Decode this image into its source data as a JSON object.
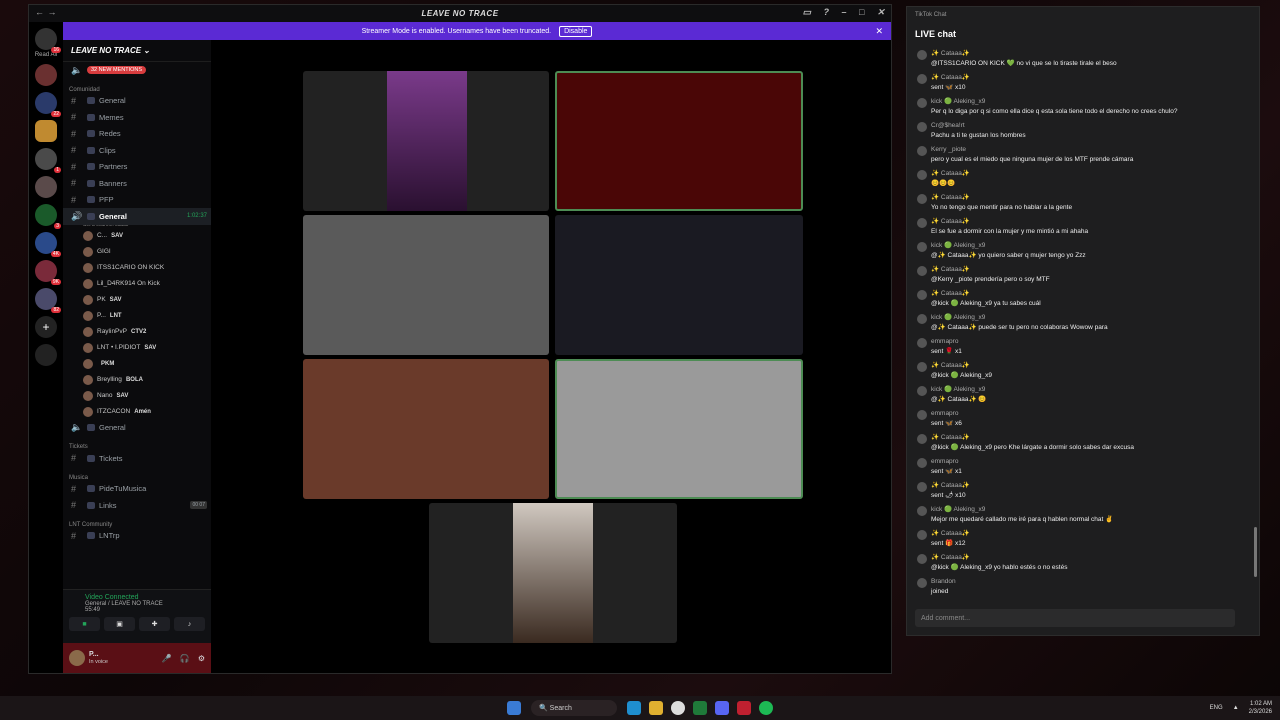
{
  "discord": {
    "window_title": "LEAVE NO TRACE",
    "read_all": "Read All",
    "banner": {
      "text": "Streamer Mode is enabled. Usernames have been truncated.",
      "disable": "Disable"
    },
    "guild_name": "LEAVE NO TRACE",
    "mentions": "32 NEW MENTIONS",
    "cat_comunidad": "Comunidad",
    "channels": [
      "General",
      "Memes",
      "Redes",
      "Clips",
      "Partners",
      "Banners",
      "PFP"
    ],
    "voice_channel": "General",
    "voice_time": "1:02:37",
    "voice_status": "Set a channel status",
    "voice_users": [
      {
        "name": "C...",
        "tag": "SAV"
      },
      {
        "name": "GIGI",
        "tag": ""
      },
      {
        "name": "ITSS1CARIO ON KICK",
        "tag": ""
      },
      {
        "name": "Lil_D4RK914 On Kick",
        "tag": ""
      },
      {
        "name": "PK",
        "tag": "SAV"
      },
      {
        "name": "P...",
        "tag": "LNT"
      },
      {
        "name": "RaylinPvP",
        "tag": "CTV2"
      },
      {
        "name": "LNT • I.PIDIOT",
        "tag": "SAV"
      },
      {
        "name": "",
        "tag": "PKM"
      },
      {
        "name": "Breylling",
        "tag": "BOLA"
      },
      {
        "name": "Nano",
        "tag": "SAV"
      },
      {
        "name": "ITZCACON",
        "tag": "Amén"
      }
    ],
    "voice_channel2": "General",
    "cat_tickets": "Tickets",
    "tickets": "Tickets",
    "cat_musica": "Musica",
    "musica": [
      "PideTuMusica",
      "Links"
    ],
    "links_counts": "00 07",
    "cat_lnt": "LNT Community",
    "lnt_channel": "LNTrp",
    "vc_status": "Video Connected",
    "vc_channel": "General / LEAVE NO TRACE",
    "vc_time": "55:49",
    "user_name": "P...",
    "user_status": "In voice"
  },
  "chat": {
    "window": "TikTok Chat",
    "title": "LIVE chat",
    "messages": [
      {
        "user": "✨ Cataaa✨",
        "text": "@ITSS1CARIO ON KICK 💚 no vi que se lo tiraste tirale el beso"
      },
      {
        "user": "✨ Cataaa✨",
        "text": "sent 🦋 x10"
      },
      {
        "user": "kick 🟢 Aleking_x9",
        "text": "Per q lo diga por q si como ella dice q esta sola tiene todo el derecho no crees chulo?"
      },
      {
        "user": "Cr@$hea!rt",
        "text": "Pachu a ti te gustan los hombres"
      },
      {
        "user": "Kerry _piote",
        "text": "pero y cual es el miedo que ninguna mujer de los MTF prende cámara"
      },
      {
        "user": "✨ Cataaa✨",
        "text": "😊😊😊"
      },
      {
        "user": "✨ Cataaa✨",
        "text": "Yo no tengo que mentir para no hablar a la gente"
      },
      {
        "user": "✨ Cataaa✨",
        "text": "El se fue a dormir con la mujer y me mintió a mi ahaha"
      },
      {
        "user": "kick 🟢 Aleking_x9",
        "text": "@✨ Cataaa✨ yo quiero saber q mujer tengo yo Zzz"
      },
      {
        "user": "✨ Cataaa✨",
        "text": "@Kerry _piote prendería pero o soy MTF"
      },
      {
        "user": "✨ Cataaa✨",
        "text": "@kick 🟢 Aleking_x9 ya tu sabes cuál"
      },
      {
        "user": "kick 🟢 Aleking_x9",
        "text": "@✨ Cataaa✨ puede ser tu pero no colaboras Wowow para"
      },
      {
        "user": "emmapro",
        "text": "sent 🌹 x1"
      },
      {
        "user": "✨ Cataaa✨",
        "text": "@kick 🟢 Aleking_x9"
      },
      {
        "user": "kick 🟢 Aleking_x9",
        "text": "@✨ Cataaa✨ 😊"
      },
      {
        "user": "emmapro",
        "text": "sent 🦋 x6"
      },
      {
        "user": "✨ Cataaa✨",
        "text": "@kick 🟢 Aleking_x9 pero Khe lárgate a dormir solo sabes dar excusa"
      },
      {
        "user": "emmapro",
        "text": "sent 🦋 x1"
      },
      {
        "user": "✨ Cataaa✨",
        "text": "sent 🌶 x10"
      },
      {
        "user": "kick 🟢 Aleking_x9",
        "text": "Mejor me quedaré callado me iré para q hablen normal chat ✌"
      },
      {
        "user": "✨ Cataaa✨",
        "text": "sent 🎁 x12"
      },
      {
        "user": "✨ Cataaa✨",
        "text": "@kick 🟢 Aleking_x9 yo hablo estés o no estés"
      },
      {
        "user": "Brandon",
        "text": "joined"
      }
    ],
    "placeholder": "Add comment..."
  },
  "taskbar": {
    "search": "Search",
    "lang": "ENG",
    "time": "1:02 AM",
    "date": "2/3/2026"
  }
}
